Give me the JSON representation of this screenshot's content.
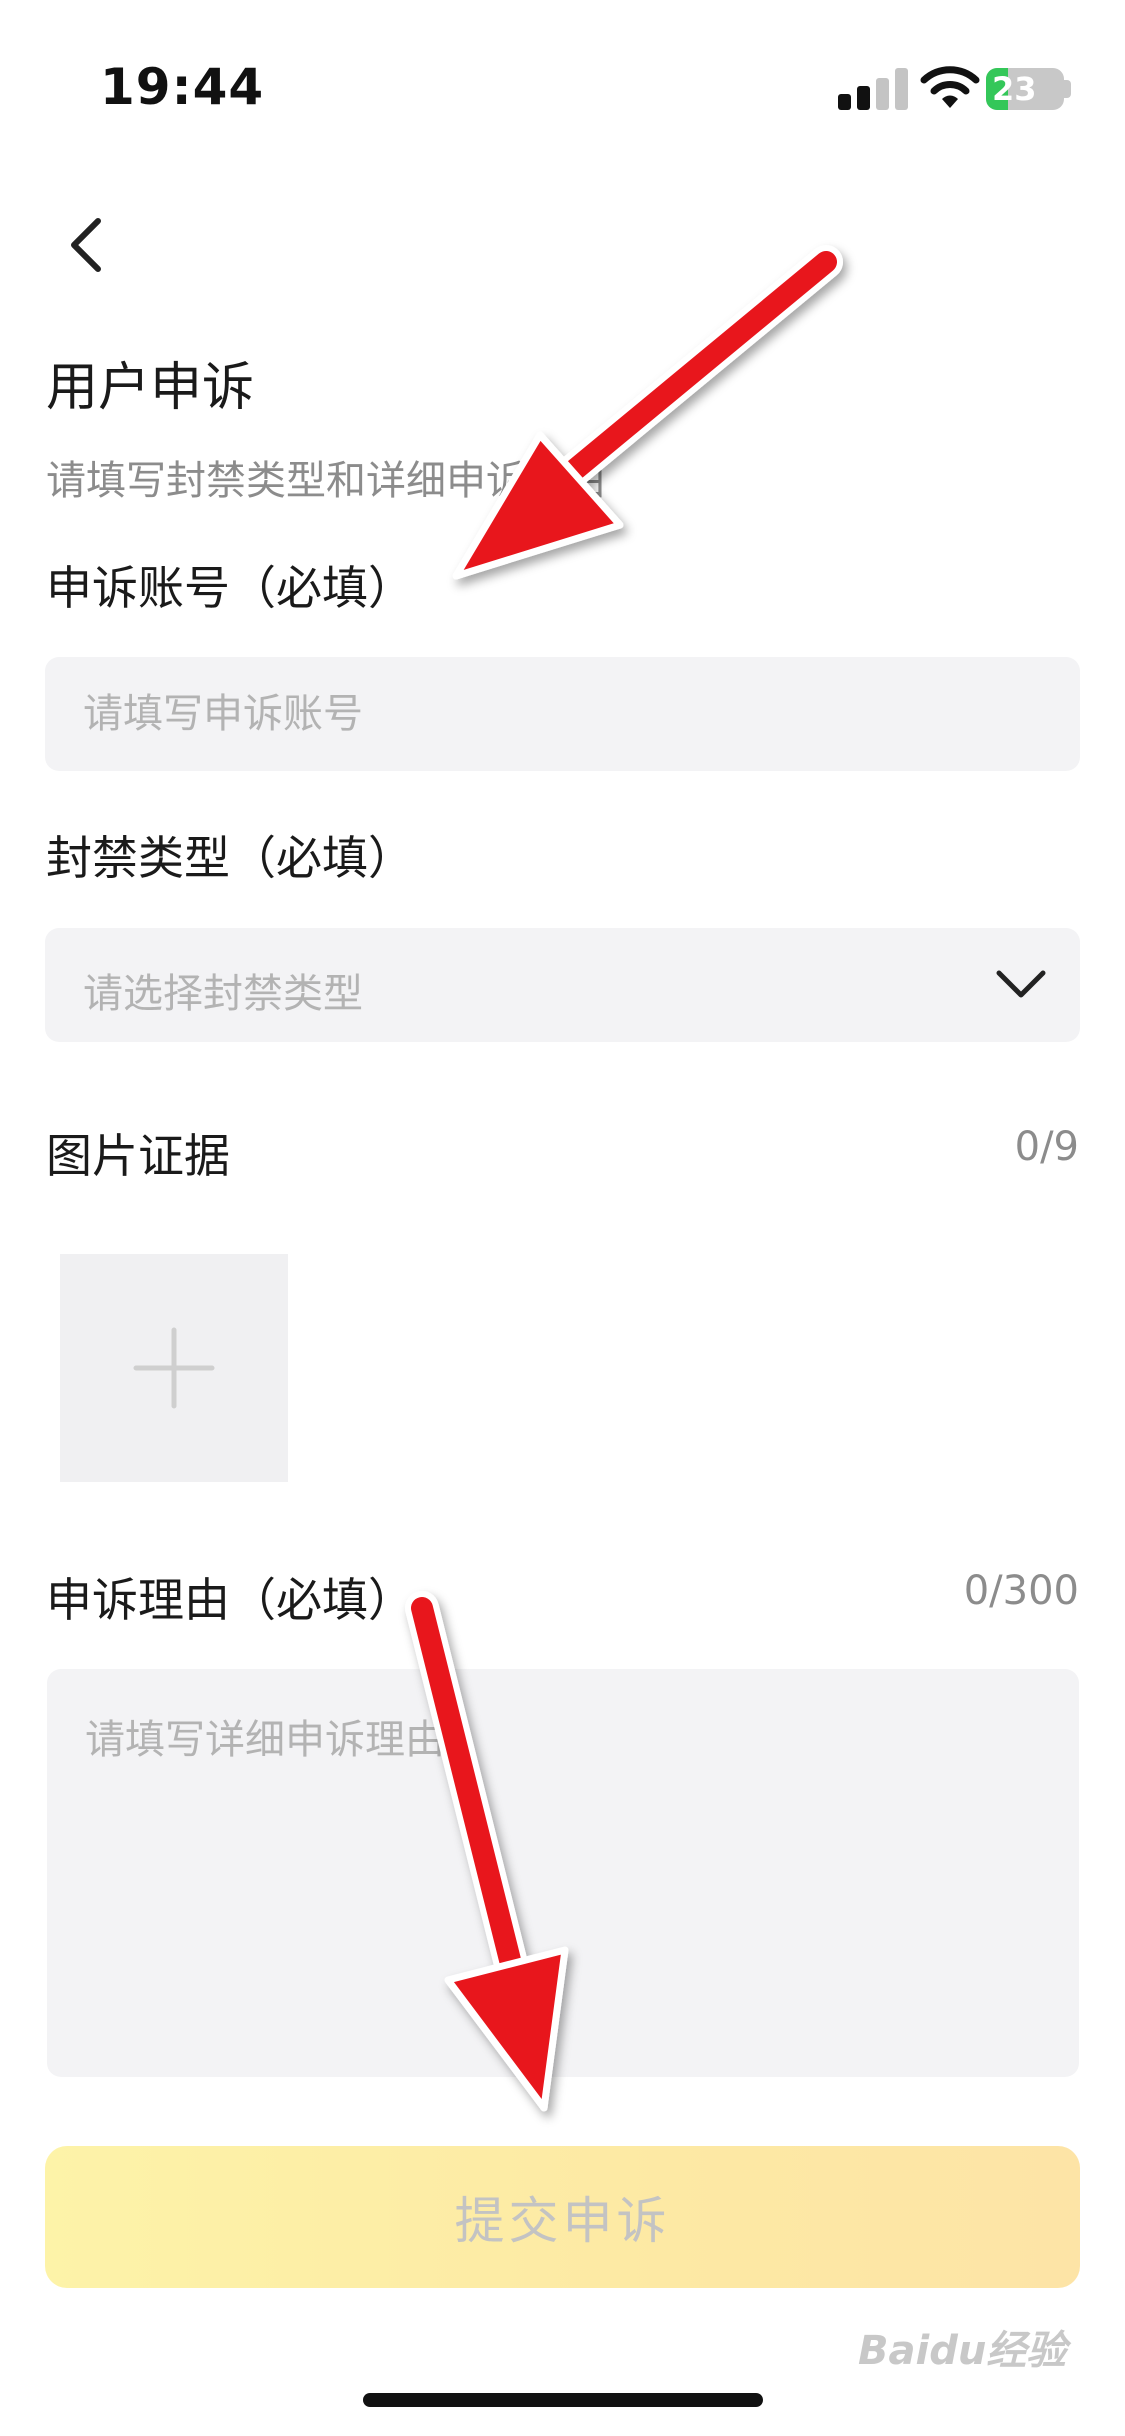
{
  "status_bar": {
    "time": "19:44",
    "battery": "23"
  },
  "page": {
    "title": "用户申诉",
    "subtitle": "请填写封禁类型和详细申诉理由"
  },
  "account": {
    "label": "申诉账号（必填）",
    "placeholder": "请填写申诉账号"
  },
  "ban_type": {
    "label": "封禁类型（必填）",
    "placeholder": "请选择封禁类型"
  },
  "evidence": {
    "label": "图片证据",
    "count": "0/9"
  },
  "reason": {
    "label": "申诉理由（必填）",
    "count": "0/300",
    "placeholder": "请填写详细申诉理由"
  },
  "submit_label": "提交申诉",
  "watermark": "Baidu经验",
  "colors": {
    "input_bg": "#f3f3f5",
    "submit_gradient_start": "#fdf3a8",
    "submit_gradient_end": "#fde4a6",
    "annotation_arrow": "#e8141e",
    "battery_green": "#34c759"
  }
}
